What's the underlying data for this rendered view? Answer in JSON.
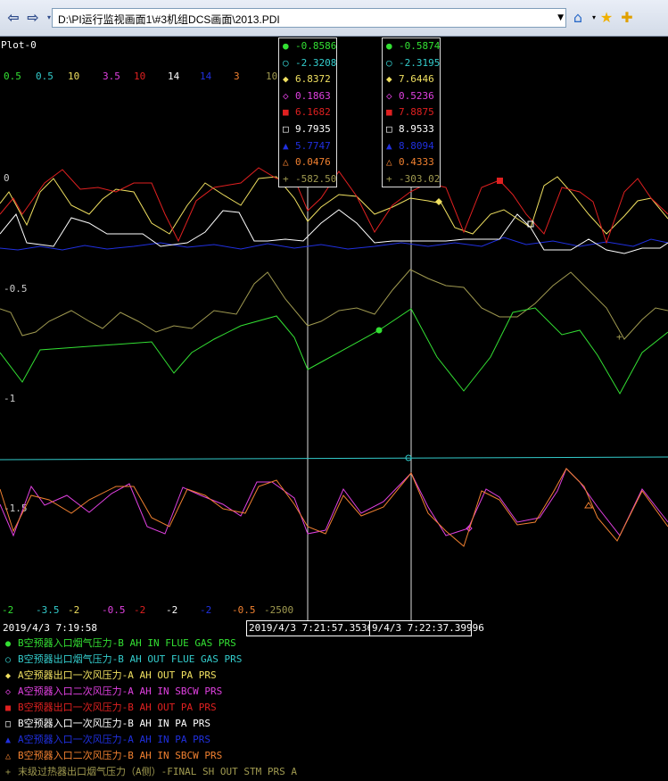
{
  "browser": {
    "address": "D:\\PI运行监视画面1\\#3机组DCS画面\\2013.PDI"
  },
  "plot": {
    "title": "Plot-0",
    "top_scales": [
      "0.5",
      "0.5",
      "10",
      "3.5",
      "10",
      "14",
      "14",
      "3",
      "10"
    ],
    "bottom_scales": [
      "-2",
      "-3.5",
      "-2",
      "-0.5",
      "-2",
      "-2",
      "-2",
      "-0.5",
      "-2500"
    ],
    "y_markers": [
      "0",
      "-0.5",
      "-1",
      "-1.5"
    ],
    "start_time": "2019/4/3 7:19:58",
    "cursor1_time": "2019/4/3 7:21:57.35366",
    "cursor2_time": "9/4/3 7:22:37.39996"
  },
  "colors": {
    "green": "#33e033",
    "cyan": "#33cccc",
    "yellow": "#f0e060",
    "magenta": "#e040e0",
    "red": "#e02020",
    "white": "#ffffff",
    "blue": "#2030e0",
    "orange": "#f08030",
    "olive": "#a09a50"
  },
  "cursor1_values": [
    {
      "symbol": "●",
      "color": "#33e033",
      "value": "-0.8586"
    },
    {
      "symbol": "○",
      "color": "#33cccc",
      "value": "-2.3208"
    },
    {
      "symbol": "◆",
      "color": "#f0e060",
      "value": "6.8372"
    },
    {
      "symbol": "◇",
      "color": "#e040e0",
      "value": "0.1863"
    },
    {
      "symbol": "■",
      "color": "#e02020",
      "value": "6.1682"
    },
    {
      "symbol": "□",
      "color": "#ffffff",
      "value": "9.7935"
    },
    {
      "symbol": "▲",
      "color": "#2030e0",
      "value": "5.7747"
    },
    {
      "symbol": "△",
      "color": "#f08030",
      "value": "0.0476"
    },
    {
      "symbol": "+",
      "color": "#a09a50",
      "value": "-582.50"
    }
  ],
  "cursor2_values": [
    {
      "symbol": "●",
      "color": "#33e033",
      "value": "-0.5874"
    },
    {
      "symbol": "○",
      "color": "#33cccc",
      "value": "-2.3195"
    },
    {
      "symbol": "◆",
      "color": "#f0e060",
      "value": "7.6446"
    },
    {
      "symbol": "◇",
      "color": "#e040e0",
      "value": "0.5236"
    },
    {
      "symbol": "■",
      "color": "#e02020",
      "value": "7.8875"
    },
    {
      "symbol": "□",
      "color": "#ffffff",
      "value": "8.9533"
    },
    {
      "symbol": "▲",
      "color": "#2030e0",
      "value": "8.8094"
    },
    {
      "symbol": "△",
      "color": "#f08030",
      "value": "0.4333"
    },
    {
      "symbol": "+",
      "color": "#a09a50",
      "value": "-303.02"
    }
  ],
  "legend": [
    {
      "symbol": "●",
      "color": "#33e033",
      "label": "B空预器入口烟气压力-B AH IN FLUE GAS PRS"
    },
    {
      "symbol": "○",
      "color": "#33cccc",
      "label": "B空预器出口烟气压力-B AH OUT FLUE GAS PRS"
    },
    {
      "symbol": "◆",
      "color": "#f0e060",
      "label": "A空预器出口一次风压力-A AH OUT PA PRS"
    },
    {
      "symbol": "◇",
      "color": "#e040e0",
      "label": "A空预器入口二次风压力-A AH IN SBCW PRS"
    },
    {
      "symbol": "■",
      "color": "#e02020",
      "label": "B空预器出口一次风压力-B AH OUT PA PRS"
    },
    {
      "symbol": "□",
      "color": "#ffffff",
      "label": "B空预器入口一次风压力-B AH IN PA PRS"
    },
    {
      "symbol": "▲",
      "color": "#2030e0",
      "label": "A空预器入口一次风压力-A AH IN PA PRS"
    },
    {
      "symbol": "△",
      "color": "#f08030",
      "label": "B空预器入口二次风压力-B AH IN SBCW PRS"
    },
    {
      "symbol": "+",
      "color": "#a09a50",
      "label": "末级过热器出口烟气压力（A侧）-FINAL SH OUT STM PRS A"
    }
  ]
}
